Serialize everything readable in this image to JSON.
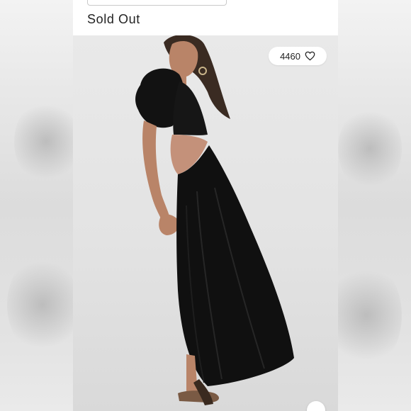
{
  "listing": {
    "status_text": "Sold Out",
    "likes_count": "4460",
    "like_icon": "heart-outline-icon"
  },
  "colors": {
    "dress": "#111111",
    "background": "#e6e6e6",
    "card": "#ffffff"
  }
}
